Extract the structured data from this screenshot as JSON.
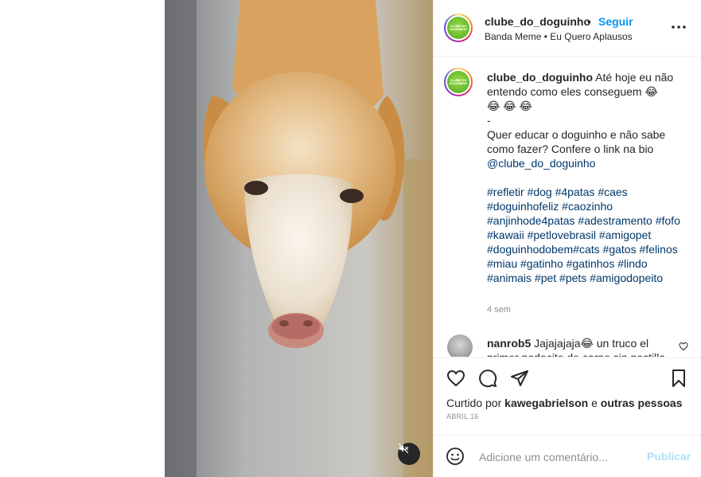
{
  "post": {
    "username": "clube_do_doguinho",
    "follow_label": "Seguir",
    "separator": "•",
    "audio": "Banda Meme • Eu Quero Aplausos",
    "logo_text": "CLUBE DO DOGUINHO"
  },
  "caption": {
    "username": "clube_do_doguinho",
    "line1": "Até hoje eu não entendo como eles conseguem 😂",
    "line2": "😂 😂 😂",
    "line3": "-",
    "line4": "Quer educar o doguinho e não sabe como fazer? Confere o link na bio",
    "mention": "@clube_do_doguinho",
    "hashtags": "#refletir #dog #4patas #caes #doguinhofeliz #caozinho #anjinhode4patas #adestramento #fofo #kawaii #petlovebrasil #amigopet #doguinhodobem#cats #gatos #felinos #miau #gatinho #gatinhos #lindo #animais #pet #pets #amigodopeito",
    "time": "4 sem"
  },
  "comment": {
    "username": "nanrob5",
    "text": "Jajajajaja😂 un truco el primer pedacito de carne sin pastilla"
  },
  "likes": {
    "prefix": "Curtido por",
    "user": "kawegabrielson",
    "middle": "e",
    "others": "outras pessoas"
  },
  "date": "ABRIL 16",
  "comment_box": {
    "placeholder": "Adicione um comentário...",
    "post_label": "Publicar"
  },
  "colors": {
    "accent": "#0095f6",
    "link": "#00376b",
    "muted": "#8e8e8e",
    "post_disabled": "#b2dffc"
  },
  "icons": [
    "more-icon",
    "heart-icon",
    "comment-icon",
    "share-icon",
    "bookmark-icon",
    "emoji-icon",
    "mute-icon",
    "like-comment-icon"
  ]
}
